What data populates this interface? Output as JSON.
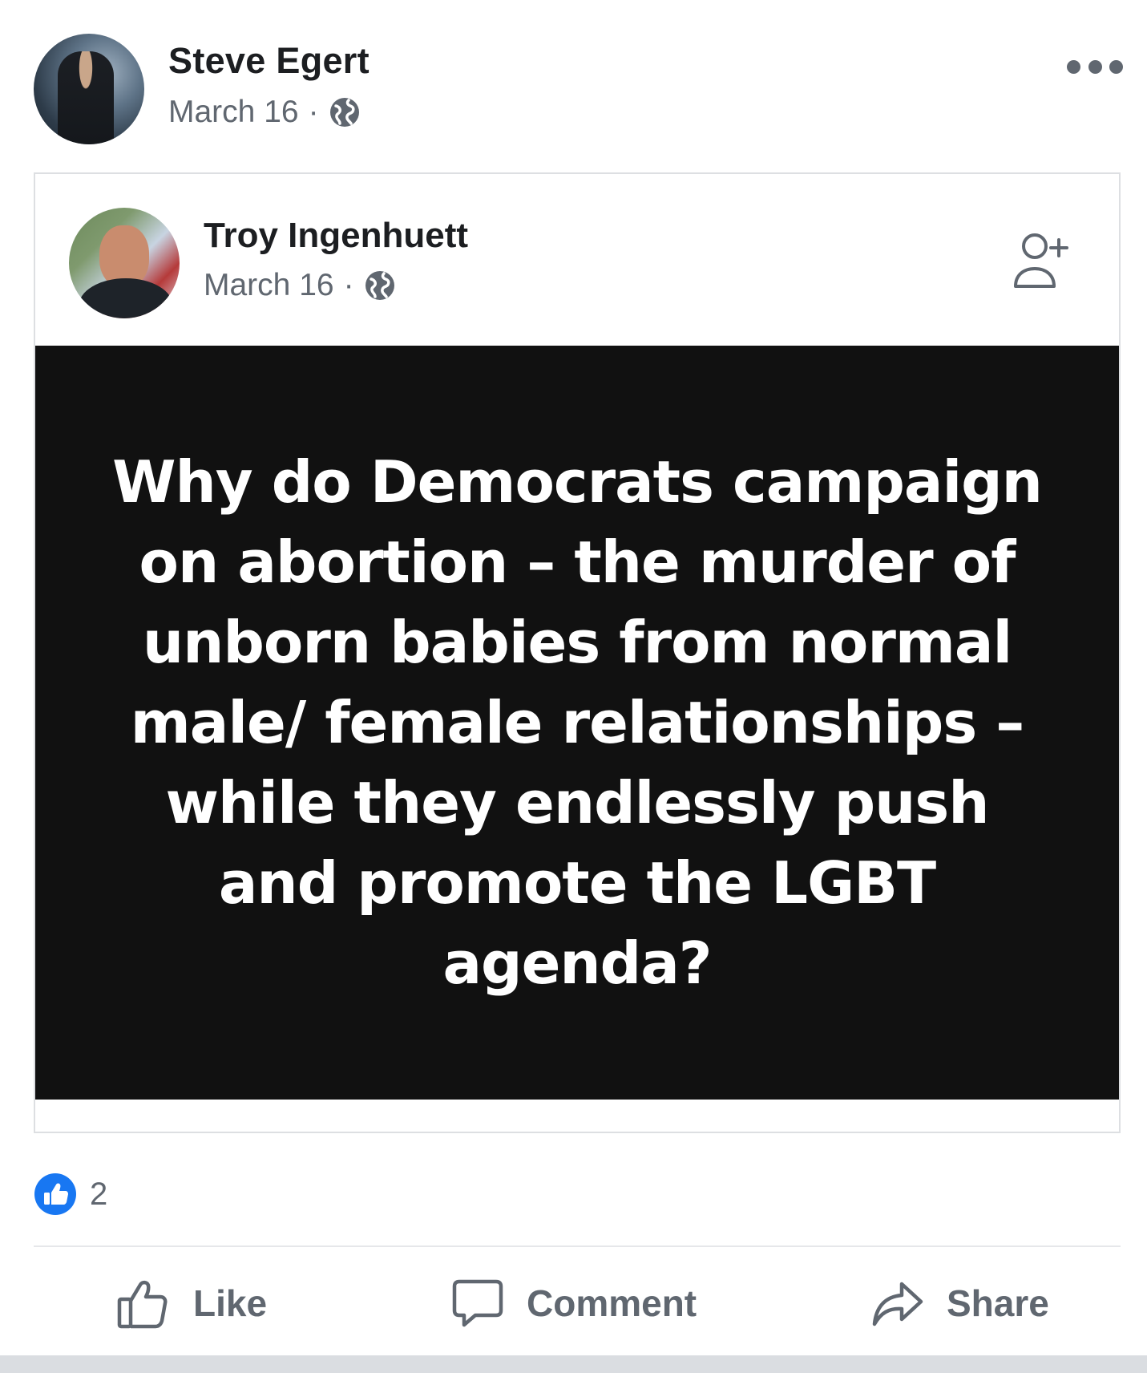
{
  "post": {
    "author": "Steve Egert",
    "date": "March 16",
    "separator": "·",
    "privacy_icon": "globe-icon",
    "menu_icon": "more-options-icon"
  },
  "shared_post": {
    "author": "Troy Ingenhuett",
    "date": "March 16",
    "separator": "·",
    "privacy_icon": "globe-icon",
    "action_icon": "add-friend-icon",
    "image_text": "Why do Democrats campaign on abortion – the murder of unborn babies from normal male/ female relationships – while they endlessly push and promote the LGBT agenda?"
  },
  "reactions": {
    "icon": "like-reaction-icon",
    "count": "2",
    "accent_color": "#1877f2"
  },
  "actions": {
    "like_label": "Like",
    "comment_label": "Comment",
    "share_label": "Share"
  }
}
